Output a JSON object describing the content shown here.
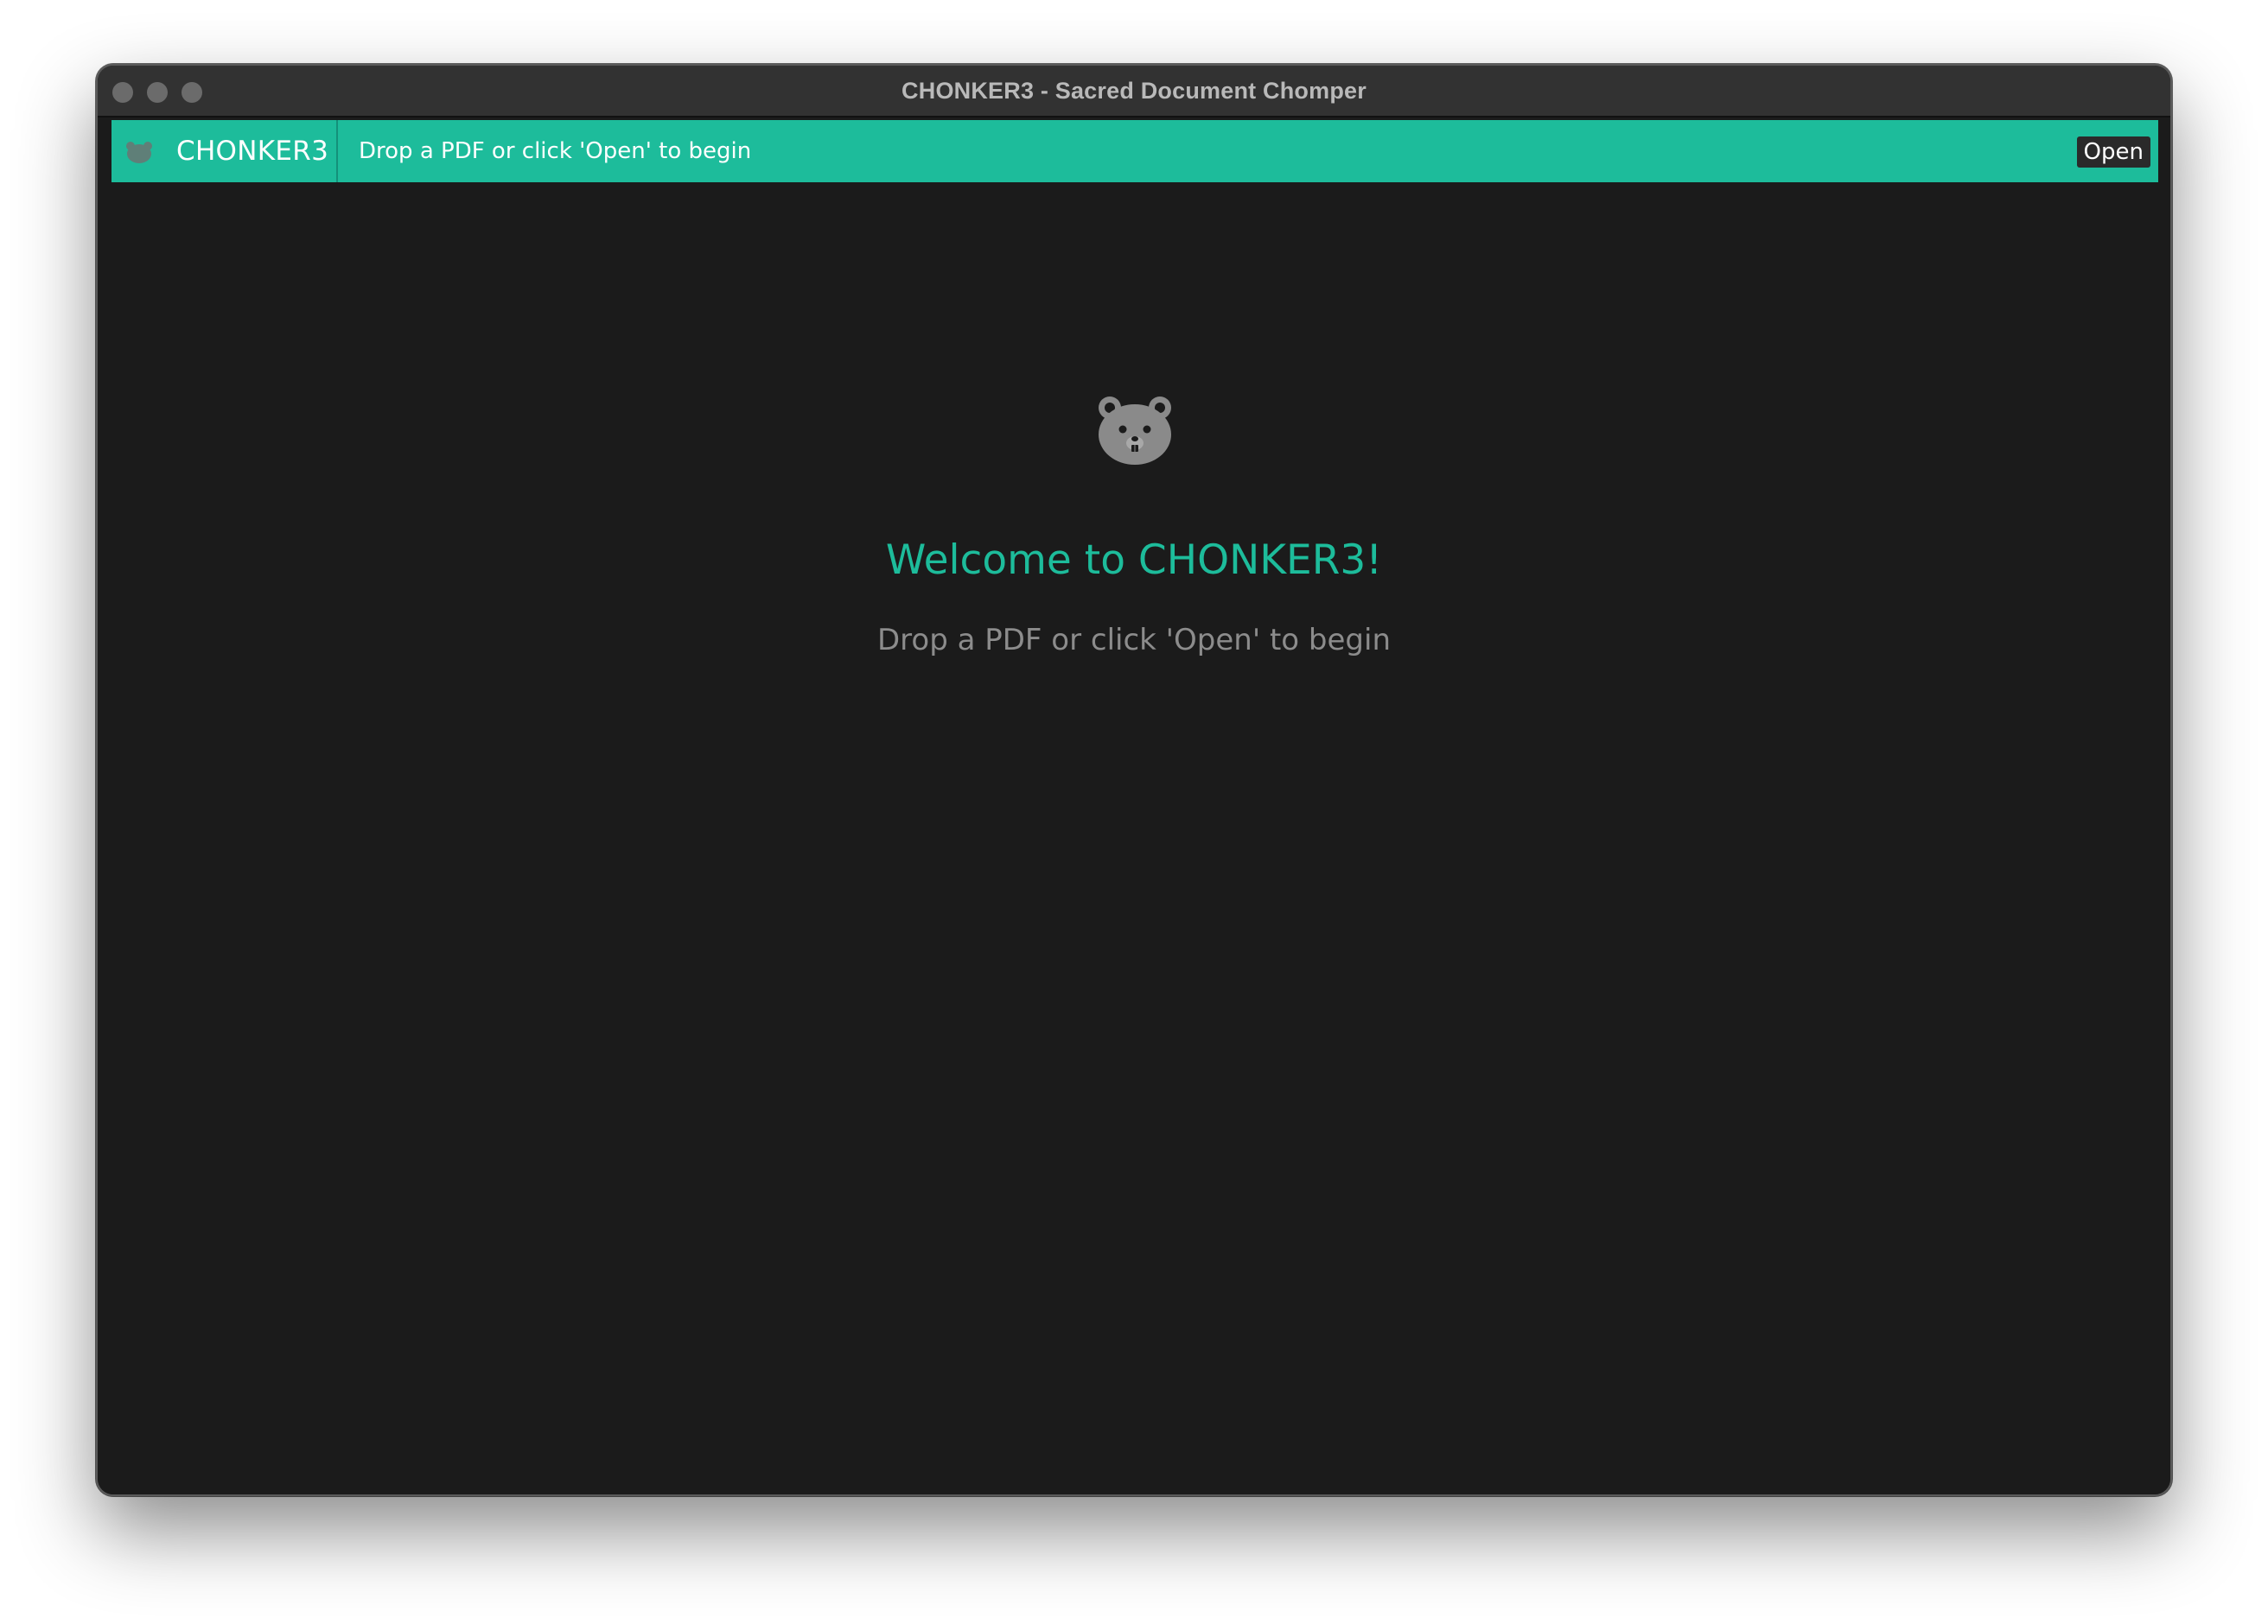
{
  "window": {
    "title": "CHONKER3 - Sacred Document Chomper"
  },
  "toolbar": {
    "brand_name": "CHONKER3",
    "brand_icon": "hamster-icon",
    "status": "Drop a PDF or click 'Open' to begin",
    "open_label": "Open"
  },
  "welcome": {
    "icon": "hamster-icon",
    "title": "Welcome to CHONKER3!",
    "subtitle": "Drop a PDF or click 'Open' to begin"
  },
  "colors": {
    "accent": "#1dbc9b",
    "background": "#1b1b1b",
    "titlebar": "#323232",
    "subtitle": "#8c8c8c"
  }
}
